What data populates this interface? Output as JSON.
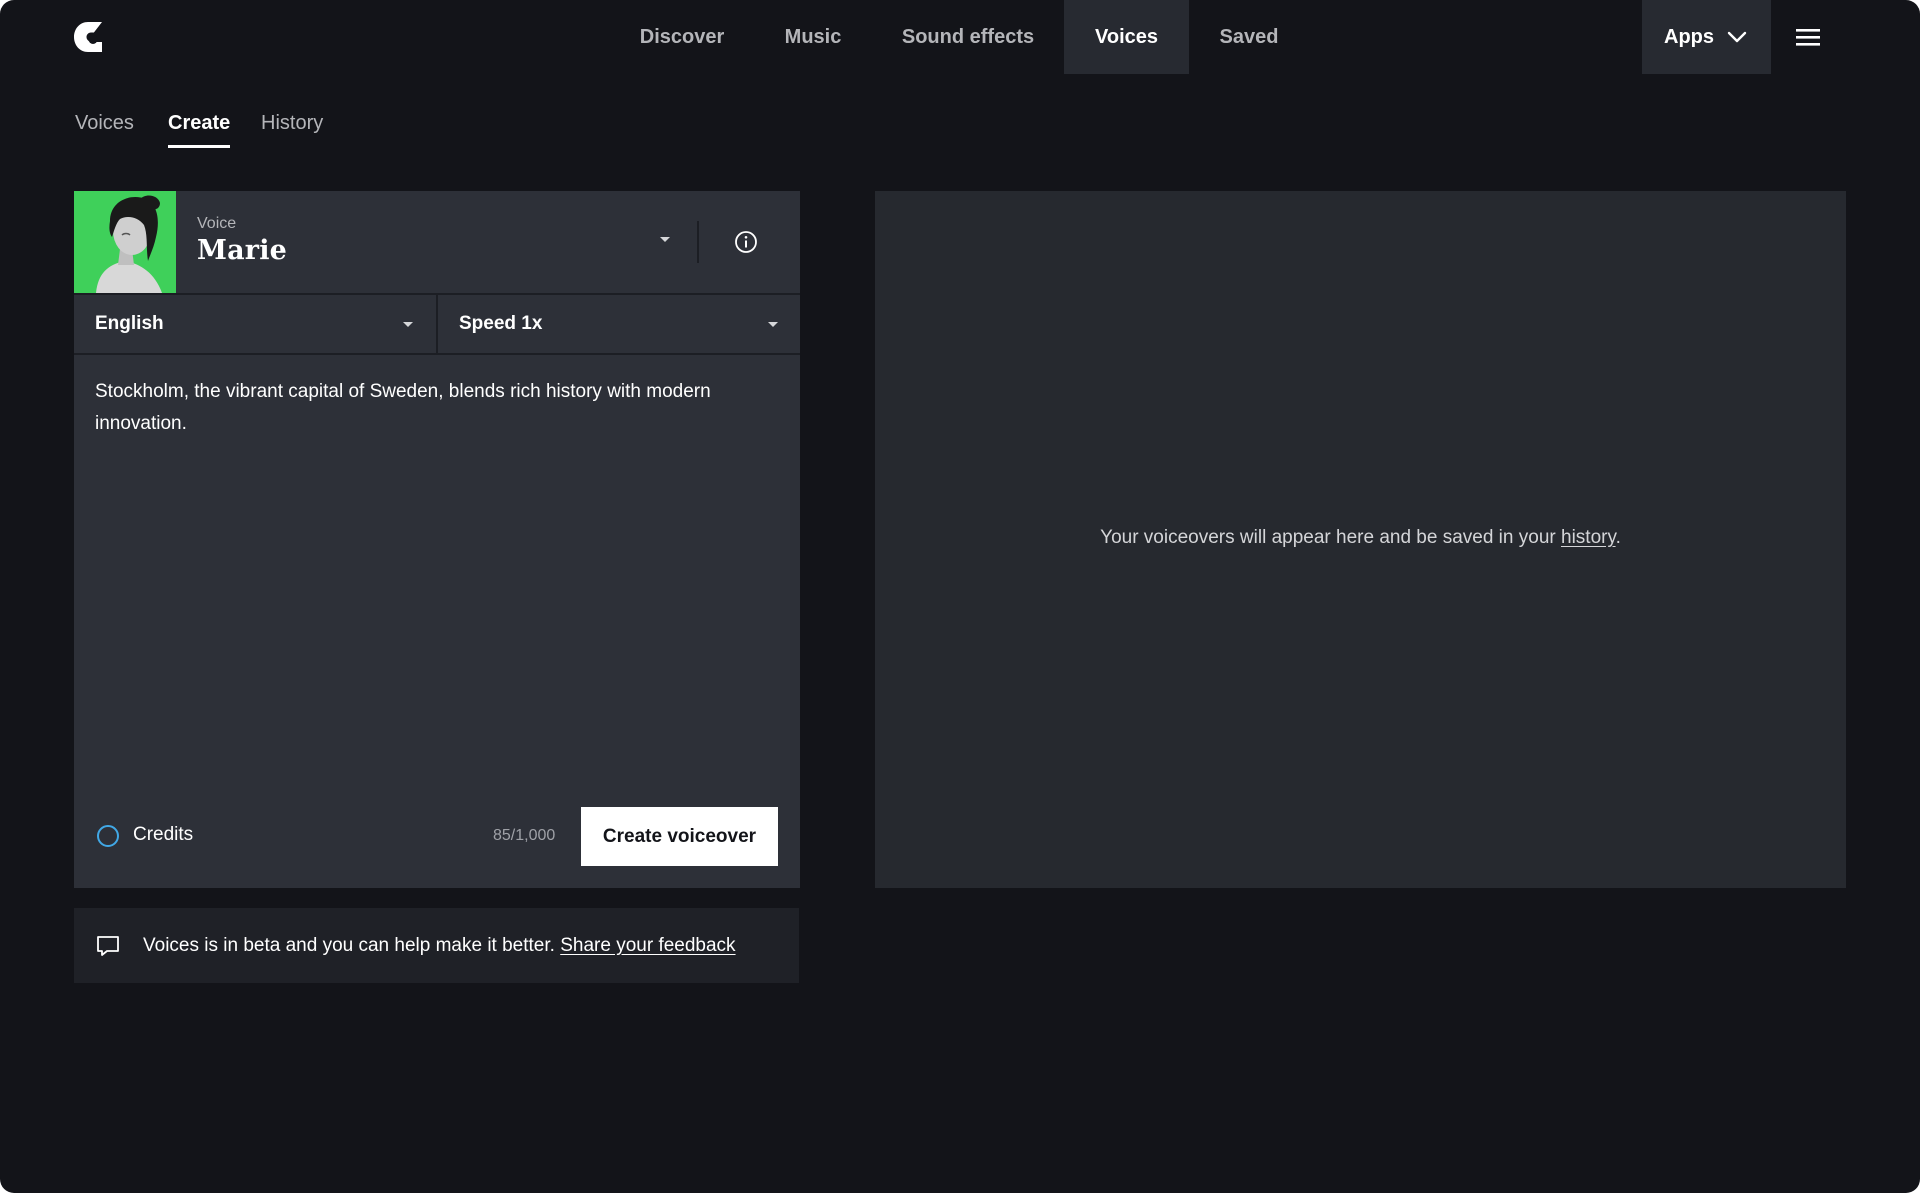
{
  "topnav": {
    "items": [
      {
        "label": "Discover",
        "active": false
      },
      {
        "label": "Music",
        "active": false
      },
      {
        "label": "Sound effects",
        "active": false
      },
      {
        "label": "Voices",
        "active": true
      },
      {
        "label": "Saved",
        "active": false
      }
    ],
    "apps_label": "Apps",
    "logo_icon": "epidemic-logo-icon",
    "menu_icon": "hamburger-menu-icon"
  },
  "subnav": {
    "items": [
      {
        "label": "Voices",
        "active": false
      },
      {
        "label": "Create",
        "active": true
      },
      {
        "label": "History",
        "active": false
      }
    ]
  },
  "voice": {
    "caption": "Voice",
    "name": "Marie"
  },
  "language": {
    "selected": "English"
  },
  "speed": {
    "selected": "Speed 1x"
  },
  "script": {
    "text": "Stockholm, the vibrant capital of Sweden, blends rich history with modern innovation."
  },
  "credits": {
    "label": "Credits",
    "count": "85/1,000",
    "ring_color": "#41a8e6"
  },
  "create_button": {
    "label": "Create voiceover"
  },
  "feedback": {
    "text": "Voices is in beta and you can help make it better.",
    "link": "Share your feedback"
  },
  "output": {
    "message_prefix": "Your voiceovers will appear here and be saved in your",
    "history_link": "history",
    "message_suffix": "."
  },
  "colors": {
    "background": "#131419",
    "panel": "#2d3038",
    "active_tab": "#272a31",
    "avatar_bg": "#3fd05a"
  }
}
